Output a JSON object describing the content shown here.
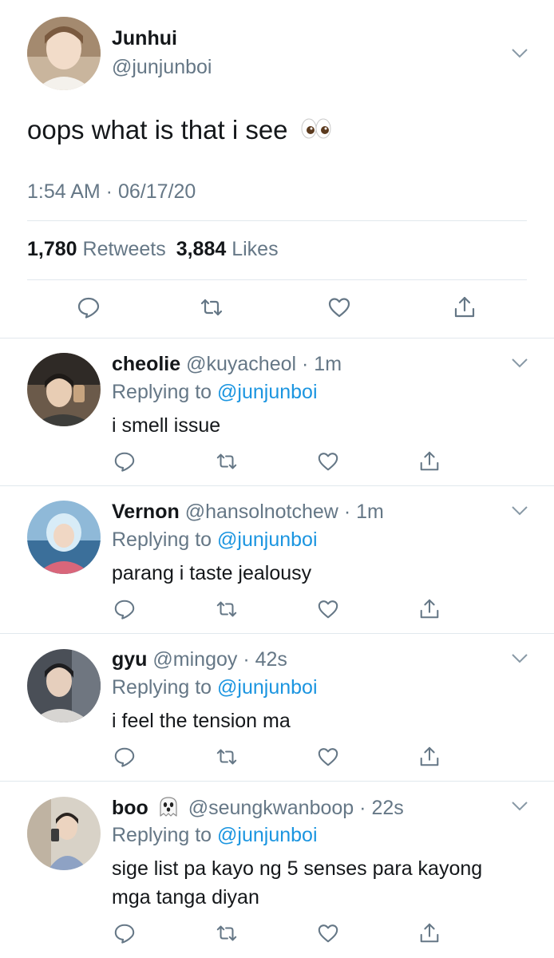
{
  "main_tweet": {
    "name": "Junhui",
    "handle": "@junjunboi",
    "text": "oops what is that i see",
    "timestamp": "1:54 AM · 06/17/20",
    "retweets_count": "1,780",
    "retweets_label": "Retweets",
    "likes_count": "3,884",
    "likes_label": "Likes"
  },
  "replies": [
    {
      "name": "cheolie",
      "handle": "@kuyacheol",
      "time": "· 1m",
      "replying_label": "Replying to",
      "replying_to": "@junjunboi",
      "text_lines": [
        "i smell issue"
      ]
    },
    {
      "name": "Vernon",
      "handle": "@hansolnotchew",
      "time": "· 1m",
      "replying_label": "Replying to",
      "replying_to": "@junjunboi",
      "text_lines": [
        "parang i taste jealousy"
      ]
    },
    {
      "name": "gyu",
      "handle": "@mingoy",
      "time": "· 42s",
      "replying_label": "Replying to",
      "replying_to": "@junjunboi",
      "text_lines": [
        "i feel the tension ma"
      ]
    },
    {
      "name": "boo",
      "handle": "@seungkwanboop",
      "time": "· 22s",
      "replying_label": "Replying to",
      "replying_to": "@junjunboi",
      "text_lines": [
        "sige list pa kayo ng 5 senses para kayong",
        "mga tanga diyan"
      ]
    }
  ],
  "icons": {
    "reply": "reply-icon",
    "retweet": "retweet-icon",
    "like": "heart-icon",
    "share": "share-icon",
    "more": "chevron-down-icon",
    "eyes": "eyes-emoji",
    "ghost": "ghost-emoji"
  },
  "colors": {
    "text": "#14171a",
    "muted": "#657786",
    "link": "#1b95e0",
    "divider": "#e1e8ed"
  }
}
